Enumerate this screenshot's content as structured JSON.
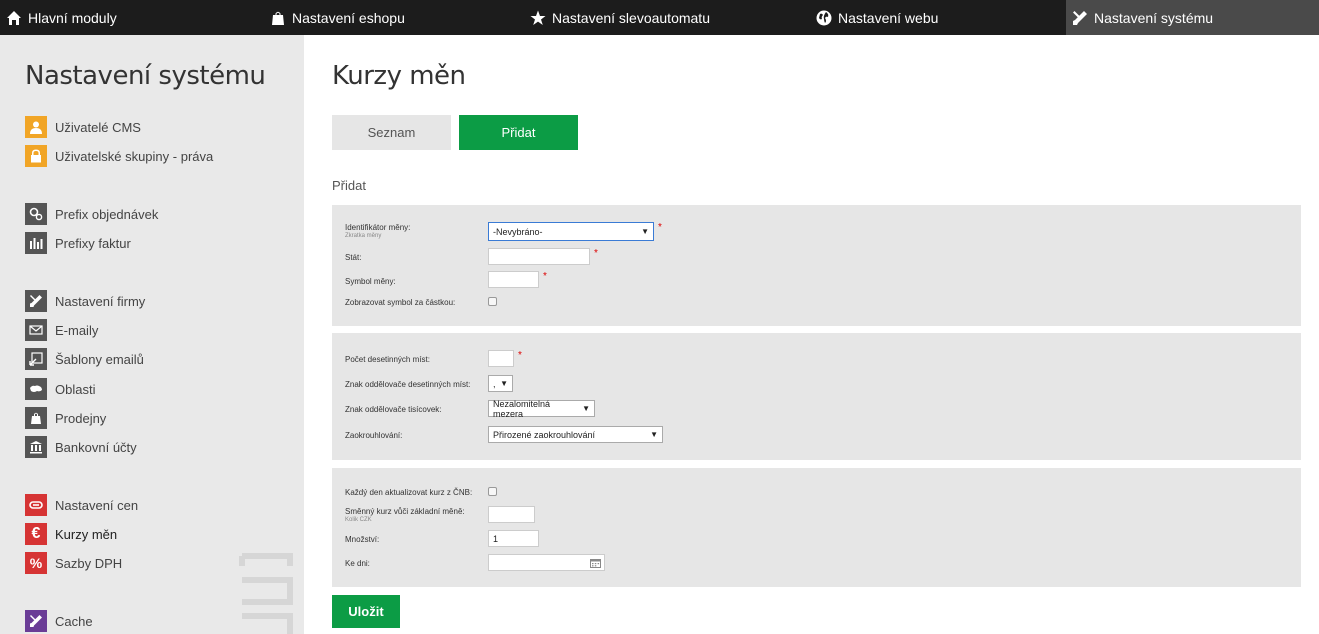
{
  "topnav": {
    "items": [
      {
        "label": "Hlavní moduly",
        "icon": "home-icon"
      },
      {
        "label": "Nastavení eshopu",
        "icon": "shopping-bag-icon"
      },
      {
        "label": "Nastavení slevoautomatu",
        "icon": "star-icon"
      },
      {
        "label": "Nastavení webu",
        "icon": "globe-icon"
      },
      {
        "label": "Nastavení systému",
        "icon": "tools-icon"
      }
    ]
  },
  "sidebar": {
    "title": "Nastavení systému",
    "items": [
      {
        "label": "Uživatelé CMS",
        "icon": "user-icon"
      },
      {
        "label": "Uživatelské skupiny - práva",
        "icon": "lock-icon"
      },
      {
        "label": "Prefix objednávek",
        "icon": "gears-icon"
      },
      {
        "label": "Prefixy faktur",
        "icon": "bar-chart-icon"
      },
      {
        "label": "Nastavení firmy",
        "icon": "tools-icon"
      },
      {
        "label": "E-maily",
        "icon": "envelope-icon"
      },
      {
        "label": "Šablony emailů",
        "icon": "template-icon"
      },
      {
        "label": "Oblasti",
        "icon": "map-icon"
      },
      {
        "label": "Prodejny",
        "icon": "shop-bag-icon"
      },
      {
        "label": "Bankovní účty",
        "icon": "bank-icon"
      },
      {
        "label": "Nastavení cen",
        "icon": "price-tag-icon"
      },
      {
        "label": "Kurzy měn",
        "icon": "euro-icon"
      },
      {
        "label": "Sazby DPH",
        "icon": "percent-icon"
      },
      {
        "label": "Cache",
        "icon": "tools-icon"
      }
    ]
  },
  "main": {
    "title": "Kurzy měn",
    "tabs": {
      "list": "Seznam",
      "add": "Přidat"
    },
    "section_title": "Přidat",
    "fields": {
      "currency_id_label": "Identifikátor měny:",
      "currency_id_sub": "Zkratka měny",
      "currency_id_value": "-Nevybráno-",
      "state_label": "Stát:",
      "state_value": "",
      "symbol_label": "Symbol měny:",
      "symbol_value": "",
      "show_symbol_label": "Zobrazovat symbol za částkou:",
      "decimals_label": "Počet desetinných míst:",
      "decimals_value": "",
      "decimal_sep_label": "Znak oddělovače desetinných míst:",
      "decimal_sep_value": ",",
      "thousand_sep_label": "Znak oddělovače tisícovek:",
      "thousand_sep_value": "Nezalomitelná mezera",
      "rounding_label": "Zaokrouhlování:",
      "rounding_value": "Přirozené zaokrouhlování",
      "daily_update_label": "Každý den aktualizovat kurz z ČNB:",
      "exchange_rate_label": "Směnný kurz vůči základní měně:",
      "exchange_rate_sub": "Kolik CZK",
      "exchange_rate_value": "",
      "amount_label": "Množství:",
      "amount_value": "1",
      "date_label": "Ke dni:",
      "date_value": "",
      "required_mark": "*"
    },
    "save_label": "Uložit"
  },
  "colors": {
    "accent_green": "#0c9c45",
    "topnav_bg": "#1c1c1c",
    "sidebar_bg": "#e9e9e9",
    "panel_bg": "#e6e6e6",
    "icon_orange": "#f1a526",
    "icon_gray": "#555555",
    "icon_red": "#d63434",
    "icon_purple": "#6a3c96"
  }
}
